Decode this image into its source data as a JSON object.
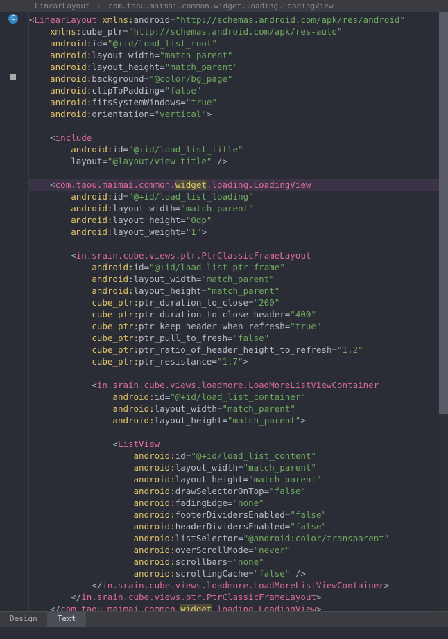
{
  "breadcrumb": {
    "item1": "LinearLayout",
    "sep": "›",
    "item2": "com.taou.maimai.common.widget.loading.LoadingView"
  },
  "lines": [
    {
      "h": false,
      "seg": [
        {
          "c": "punct",
          "t": "<"
        },
        {
          "c": "kw-pink",
          "t": "LinearLayout"
        },
        {
          "c": "punct",
          "t": " "
        },
        {
          "c": "ns",
          "t": "xmlns:"
        },
        {
          "c": "attr",
          "t": "android"
        },
        {
          "c": "eq",
          "t": "="
        },
        {
          "c": "val",
          "t": "\"http://schemas.android.com/apk/res/android\""
        }
      ]
    },
    {
      "h": false,
      "seg": [
        {
          "c": "punct",
          "t": "    "
        },
        {
          "c": "ns",
          "t": "xmlns:"
        },
        {
          "c": "attr",
          "t": "cube_ptr"
        },
        {
          "c": "eq",
          "t": "="
        },
        {
          "c": "val",
          "t": "\"http://schemas.android.com/apk/res-auto\""
        }
      ]
    },
    {
      "h": false,
      "seg": [
        {
          "c": "punct",
          "t": "    "
        },
        {
          "c": "ns",
          "t": "android:"
        },
        {
          "c": "attr",
          "t": "id"
        },
        {
          "c": "eq",
          "t": "="
        },
        {
          "c": "val",
          "t": "\"@+id/load_list_root\""
        }
      ]
    },
    {
      "h": false,
      "seg": [
        {
          "c": "punct",
          "t": "    "
        },
        {
          "c": "ns",
          "t": "android:"
        },
        {
          "c": "attr",
          "t": "layout_width"
        },
        {
          "c": "eq",
          "t": "="
        },
        {
          "c": "val",
          "t": "\"match_parent\""
        }
      ]
    },
    {
      "h": false,
      "seg": [
        {
          "c": "punct",
          "t": "    "
        },
        {
          "c": "ns",
          "t": "android:"
        },
        {
          "c": "attr",
          "t": "layout_height"
        },
        {
          "c": "eq",
          "t": "="
        },
        {
          "c": "val",
          "t": "\"match_parent\""
        }
      ]
    },
    {
      "h": false,
      "seg": [
        {
          "c": "punct",
          "t": "    "
        },
        {
          "c": "ns",
          "t": "android:"
        },
        {
          "c": "attr",
          "t": "background"
        },
        {
          "c": "eq",
          "t": "="
        },
        {
          "c": "val",
          "t": "\"@color/bg_page\""
        }
      ]
    },
    {
      "h": false,
      "seg": [
        {
          "c": "punct",
          "t": "    "
        },
        {
          "c": "ns",
          "t": "android:"
        },
        {
          "c": "attr",
          "t": "clipToPadding"
        },
        {
          "c": "eq",
          "t": "="
        },
        {
          "c": "val",
          "t": "\"false\""
        }
      ]
    },
    {
      "h": false,
      "seg": [
        {
          "c": "punct",
          "t": "    "
        },
        {
          "c": "ns",
          "t": "android:"
        },
        {
          "c": "attr",
          "t": "fitsSystemWindows"
        },
        {
          "c": "eq",
          "t": "="
        },
        {
          "c": "val",
          "t": "\"true\""
        }
      ]
    },
    {
      "h": false,
      "seg": [
        {
          "c": "punct",
          "t": "    "
        },
        {
          "c": "ns",
          "t": "android:"
        },
        {
          "c": "attr",
          "t": "orientation"
        },
        {
          "c": "eq",
          "t": "="
        },
        {
          "c": "val",
          "t": "\"vertical\""
        },
        {
          "c": "punct",
          "t": ">"
        }
      ]
    },
    {
      "h": false,
      "seg": [
        {
          "c": "punct",
          "t": ""
        }
      ]
    },
    {
      "h": false,
      "seg": [
        {
          "c": "punct",
          "t": "    <"
        },
        {
          "c": "kw-pink",
          "t": "include"
        }
      ]
    },
    {
      "h": false,
      "seg": [
        {
          "c": "punct",
          "t": "        "
        },
        {
          "c": "ns",
          "t": "android:"
        },
        {
          "c": "attr",
          "t": "id"
        },
        {
          "c": "eq",
          "t": "="
        },
        {
          "c": "val",
          "t": "\"@+id/load_list_title\""
        }
      ]
    },
    {
      "h": false,
      "seg": [
        {
          "c": "punct",
          "t": "        "
        },
        {
          "c": "attr",
          "t": "layout"
        },
        {
          "c": "eq",
          "t": "="
        },
        {
          "c": "val",
          "t": "\"@layout/view_title\""
        },
        {
          "c": "punct",
          "t": " />"
        }
      ]
    },
    {
      "h": false,
      "seg": [
        {
          "c": "punct",
          "t": ""
        }
      ]
    },
    {
      "h": true,
      "seg": [
        {
          "c": "punct",
          "t": "    <"
        },
        {
          "c": "kw-pink",
          "t": "com.taou.maimai.common."
        },
        {
          "c": "hl",
          "t": "widget"
        },
        {
          "c": "kw-pink",
          "t": ".loading.LoadingView"
        }
      ]
    },
    {
      "h": false,
      "seg": [
        {
          "c": "punct",
          "t": "        "
        },
        {
          "c": "ns",
          "t": "android:"
        },
        {
          "c": "attr",
          "t": "id"
        },
        {
          "c": "eq",
          "t": "="
        },
        {
          "c": "val",
          "t": "\"@+id/load_list_loading\""
        }
      ]
    },
    {
      "h": false,
      "seg": [
        {
          "c": "punct",
          "t": "        "
        },
        {
          "c": "ns",
          "t": "android:"
        },
        {
          "c": "attr",
          "t": "layout_width"
        },
        {
          "c": "eq",
          "t": "="
        },
        {
          "c": "val",
          "t": "\"match_parent\""
        }
      ]
    },
    {
      "h": false,
      "seg": [
        {
          "c": "punct",
          "t": "        "
        },
        {
          "c": "ns",
          "t": "android:"
        },
        {
          "c": "attr",
          "t": "layout_height"
        },
        {
          "c": "eq",
          "t": "="
        },
        {
          "c": "val",
          "t": "\"0dp\""
        }
      ]
    },
    {
      "h": false,
      "seg": [
        {
          "c": "punct",
          "t": "        "
        },
        {
          "c": "ns",
          "t": "android:"
        },
        {
          "c": "attr",
          "t": "layout_weight"
        },
        {
          "c": "eq",
          "t": "="
        },
        {
          "c": "val",
          "t": "\"1\""
        },
        {
          "c": "punct",
          "t": ">"
        }
      ]
    },
    {
      "h": false,
      "seg": [
        {
          "c": "punct",
          "t": ""
        }
      ]
    },
    {
      "h": false,
      "seg": [
        {
          "c": "punct",
          "t": "        <"
        },
        {
          "c": "kw-pink",
          "t": "in.srain.cube.views.ptr.PtrClassicFrameLayout"
        }
      ]
    },
    {
      "h": false,
      "seg": [
        {
          "c": "punct",
          "t": "            "
        },
        {
          "c": "ns",
          "t": "android:"
        },
        {
          "c": "attr",
          "t": "id"
        },
        {
          "c": "eq",
          "t": "="
        },
        {
          "c": "val",
          "t": "\"@+id/load_list_ptr_frame\""
        }
      ]
    },
    {
      "h": false,
      "seg": [
        {
          "c": "punct",
          "t": "            "
        },
        {
          "c": "ns",
          "t": "android:"
        },
        {
          "c": "attr",
          "t": "layout_width"
        },
        {
          "c": "eq",
          "t": "="
        },
        {
          "c": "val",
          "t": "\"match_parent\""
        }
      ]
    },
    {
      "h": false,
      "seg": [
        {
          "c": "punct",
          "t": "            "
        },
        {
          "c": "ns",
          "t": "android:"
        },
        {
          "c": "attr",
          "t": "layout_height"
        },
        {
          "c": "eq",
          "t": "="
        },
        {
          "c": "val",
          "t": "\"match_parent\""
        }
      ]
    },
    {
      "h": false,
      "seg": [
        {
          "c": "punct",
          "t": "            "
        },
        {
          "c": "ns",
          "t": "cube_ptr:"
        },
        {
          "c": "attr",
          "t": "ptr_duration_to_close"
        },
        {
          "c": "eq",
          "t": "="
        },
        {
          "c": "val",
          "t": "\"200\""
        }
      ]
    },
    {
      "h": false,
      "seg": [
        {
          "c": "punct",
          "t": "            "
        },
        {
          "c": "ns",
          "t": "cube_ptr:"
        },
        {
          "c": "attr",
          "t": "ptr_duration_to_close_header"
        },
        {
          "c": "eq",
          "t": "="
        },
        {
          "c": "val",
          "t": "\"400\""
        }
      ]
    },
    {
      "h": false,
      "seg": [
        {
          "c": "punct",
          "t": "            "
        },
        {
          "c": "ns",
          "t": "cube_ptr:"
        },
        {
          "c": "attr",
          "t": "ptr_keep_header_when_refresh"
        },
        {
          "c": "eq",
          "t": "="
        },
        {
          "c": "val",
          "t": "\"true\""
        }
      ]
    },
    {
      "h": false,
      "seg": [
        {
          "c": "punct",
          "t": "            "
        },
        {
          "c": "ns",
          "t": "cube_ptr:"
        },
        {
          "c": "attr",
          "t": "ptr_pull_to_fresh"
        },
        {
          "c": "eq",
          "t": "="
        },
        {
          "c": "val",
          "t": "\"false\""
        }
      ]
    },
    {
      "h": false,
      "seg": [
        {
          "c": "punct",
          "t": "            "
        },
        {
          "c": "ns",
          "t": "cube_ptr:"
        },
        {
          "c": "attr",
          "t": "ptr_ratio_of_header_height_to_refresh"
        },
        {
          "c": "eq",
          "t": "="
        },
        {
          "c": "val",
          "t": "\"1.2\""
        }
      ]
    },
    {
      "h": false,
      "seg": [
        {
          "c": "punct",
          "t": "            "
        },
        {
          "c": "ns",
          "t": "cube_ptr:"
        },
        {
          "c": "attr",
          "t": "ptr_resistance"
        },
        {
          "c": "eq",
          "t": "="
        },
        {
          "c": "val",
          "t": "\"1.7\""
        },
        {
          "c": "punct",
          "t": ">"
        }
      ]
    },
    {
      "h": false,
      "seg": [
        {
          "c": "punct",
          "t": ""
        }
      ]
    },
    {
      "h": false,
      "seg": [
        {
          "c": "punct",
          "t": "            <"
        },
        {
          "c": "kw-pink",
          "t": "in.srain.cube.views.loadmore.LoadMoreListViewContainer"
        }
      ]
    },
    {
      "h": false,
      "seg": [
        {
          "c": "punct",
          "t": "                "
        },
        {
          "c": "ns",
          "t": "android:"
        },
        {
          "c": "attr",
          "t": "id"
        },
        {
          "c": "eq",
          "t": "="
        },
        {
          "c": "val",
          "t": "\"@+id/load_list_container\""
        }
      ]
    },
    {
      "h": false,
      "seg": [
        {
          "c": "punct",
          "t": "                "
        },
        {
          "c": "ns",
          "t": "android:"
        },
        {
          "c": "attr",
          "t": "layout_width"
        },
        {
          "c": "eq",
          "t": "="
        },
        {
          "c": "val",
          "t": "\"match_parent\""
        }
      ]
    },
    {
      "h": false,
      "seg": [
        {
          "c": "punct",
          "t": "                "
        },
        {
          "c": "ns",
          "t": "android:"
        },
        {
          "c": "attr",
          "t": "layout_height"
        },
        {
          "c": "eq",
          "t": "="
        },
        {
          "c": "val",
          "t": "\"match_parent\""
        },
        {
          "c": "punct",
          "t": ">"
        }
      ]
    },
    {
      "h": false,
      "seg": [
        {
          "c": "punct",
          "t": ""
        }
      ]
    },
    {
      "h": false,
      "seg": [
        {
          "c": "punct",
          "t": "                <"
        },
        {
          "c": "kw-pink",
          "t": "ListView"
        }
      ]
    },
    {
      "h": false,
      "seg": [
        {
          "c": "punct",
          "t": "                    "
        },
        {
          "c": "ns",
          "t": "android:"
        },
        {
          "c": "attr",
          "t": "id"
        },
        {
          "c": "eq",
          "t": "="
        },
        {
          "c": "val",
          "t": "\"@+id/load_list_content\""
        }
      ]
    },
    {
      "h": false,
      "seg": [
        {
          "c": "punct",
          "t": "                    "
        },
        {
          "c": "ns",
          "t": "android:"
        },
        {
          "c": "attr",
          "t": "layout_width"
        },
        {
          "c": "eq",
          "t": "="
        },
        {
          "c": "val",
          "t": "\"match_parent\""
        }
      ]
    },
    {
      "h": false,
      "seg": [
        {
          "c": "punct",
          "t": "                    "
        },
        {
          "c": "ns",
          "t": "android:"
        },
        {
          "c": "attr",
          "t": "layout_height"
        },
        {
          "c": "eq",
          "t": "="
        },
        {
          "c": "val",
          "t": "\"match_parent\""
        }
      ]
    },
    {
      "h": false,
      "seg": [
        {
          "c": "punct",
          "t": "                    "
        },
        {
          "c": "ns",
          "t": "android:"
        },
        {
          "c": "attr",
          "t": "drawSelectorOnTop"
        },
        {
          "c": "eq",
          "t": "="
        },
        {
          "c": "val",
          "t": "\"false\""
        }
      ]
    },
    {
      "h": false,
      "seg": [
        {
          "c": "punct",
          "t": "                    "
        },
        {
          "c": "ns",
          "t": "android:"
        },
        {
          "c": "attr",
          "t": "fadingEdge"
        },
        {
          "c": "eq",
          "t": "="
        },
        {
          "c": "val",
          "t": "\"none\""
        }
      ]
    },
    {
      "h": false,
      "seg": [
        {
          "c": "punct",
          "t": "                    "
        },
        {
          "c": "ns",
          "t": "android:"
        },
        {
          "c": "attr",
          "t": "footerDividersEnabled"
        },
        {
          "c": "eq",
          "t": "="
        },
        {
          "c": "val",
          "t": "\"false\""
        }
      ]
    },
    {
      "h": false,
      "seg": [
        {
          "c": "punct",
          "t": "                    "
        },
        {
          "c": "ns",
          "t": "android:"
        },
        {
          "c": "attr",
          "t": "headerDividersEnabled"
        },
        {
          "c": "eq",
          "t": "="
        },
        {
          "c": "val",
          "t": "\"false\""
        }
      ]
    },
    {
      "h": false,
      "seg": [
        {
          "c": "punct",
          "t": "                    "
        },
        {
          "c": "ns",
          "t": "android:"
        },
        {
          "c": "attr",
          "t": "listSelector"
        },
        {
          "c": "eq",
          "t": "="
        },
        {
          "c": "val",
          "t": "\"@android:color/transparent\""
        }
      ]
    },
    {
      "h": false,
      "seg": [
        {
          "c": "punct",
          "t": "                    "
        },
        {
          "c": "ns",
          "t": "android:"
        },
        {
          "c": "attr",
          "t": "overScrollMode"
        },
        {
          "c": "eq",
          "t": "="
        },
        {
          "c": "val",
          "t": "\"never\""
        }
      ]
    },
    {
      "h": false,
      "seg": [
        {
          "c": "punct",
          "t": "                    "
        },
        {
          "c": "ns",
          "t": "android:"
        },
        {
          "c": "attr",
          "t": "scrollbars"
        },
        {
          "c": "eq",
          "t": "="
        },
        {
          "c": "val",
          "t": "\"none\""
        }
      ]
    },
    {
      "h": false,
      "seg": [
        {
          "c": "punct",
          "t": "                    "
        },
        {
          "c": "ns",
          "t": "android:"
        },
        {
          "c": "attr",
          "t": "scrollingCache"
        },
        {
          "c": "eq",
          "t": "="
        },
        {
          "c": "val",
          "t": "\"false\""
        },
        {
          "c": "punct",
          "t": " />"
        }
      ]
    },
    {
      "h": false,
      "seg": [
        {
          "c": "punct",
          "t": "            </"
        },
        {
          "c": "kw-pink",
          "t": "in.srain.cube.views.loadmore.LoadMoreListViewContainer"
        },
        {
          "c": "punct",
          "t": ">"
        }
      ]
    },
    {
      "h": false,
      "seg": [
        {
          "c": "punct",
          "t": "        </"
        },
        {
          "c": "kw-pink",
          "t": "in.srain.cube.views.ptr.PtrClassicFrameLayout"
        },
        {
          "c": "punct",
          "t": ">"
        }
      ]
    },
    {
      "h": false,
      "seg": [
        {
          "c": "punct",
          "t": "    </"
        },
        {
          "c": "kw-pink",
          "t": "com.taou.maimai.common."
        },
        {
          "c": "hl",
          "t": "widget"
        },
        {
          "c": "kw-pink",
          "t": ".loading.LoadingView"
        },
        {
          "c": "punct",
          "t": ">"
        }
      ]
    }
  ],
  "tabs": {
    "design": "Design",
    "text": "Text"
  }
}
